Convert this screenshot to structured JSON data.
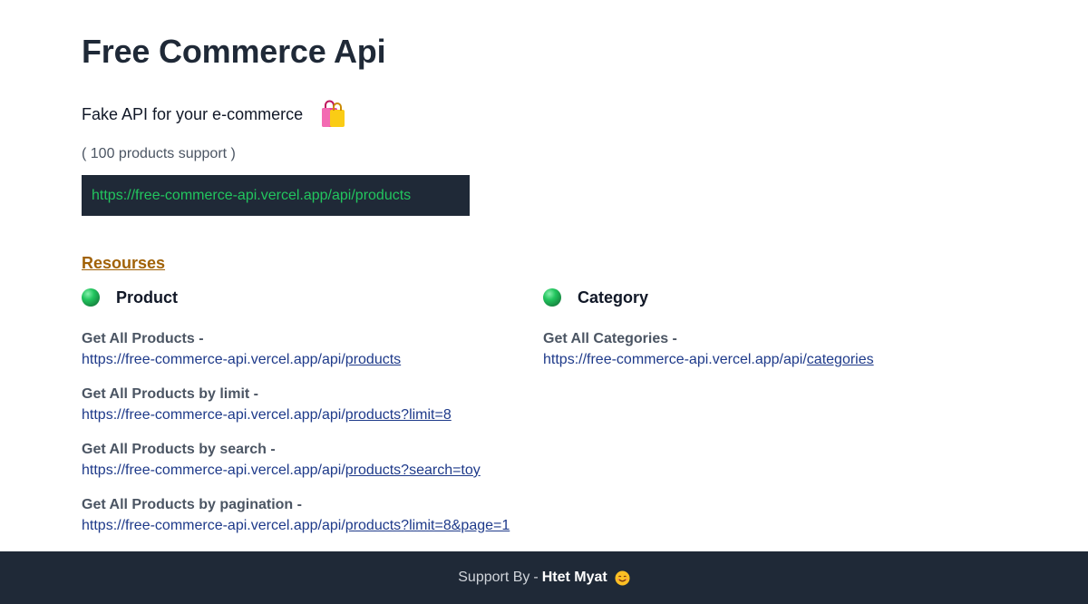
{
  "header": {
    "title": "Free Commerce Api",
    "tagline": "Fake API for your e-commerce",
    "tagline_icon": "shopping-bags-icon",
    "support_count": "( 100 products support )",
    "base_url": "https://free-commerce-api.vercel.app/api/products"
  },
  "resources": {
    "heading": "Resourses",
    "product": {
      "label": "Product",
      "icon": "green-circle-icon",
      "endpoints": [
        {
          "title": "Get All Products -",
          "base": "https://free-commerce-api.vercel.app/api/",
          "path": "products"
        },
        {
          "title": "Get All Products by limit -",
          "base": "https://free-commerce-api.vercel.app/api/",
          "path": "products?limit=8"
        },
        {
          "title": "Get All Products by search -",
          "base": "https://free-commerce-api.vercel.app/api/",
          "path": "products?search=toy"
        },
        {
          "title": "Get All Products by pagination -",
          "base": "https://free-commerce-api.vercel.app/api/",
          "path": "products?limit=8&page=1"
        }
      ]
    },
    "category": {
      "label": "Category",
      "icon": "green-circle-icon",
      "endpoints": [
        {
          "title": "Get All Categories -",
          "base": "https://free-commerce-api.vercel.app/api/",
          "path": "categories"
        }
      ]
    }
  },
  "footer": {
    "label": "Support By",
    "separator": "-",
    "author": "Htet Myat",
    "icon": "smiling-face-icon"
  },
  "colors": {
    "dark_bg": "#1f2937",
    "code_text": "#22c55e",
    "resources_heading": "#a16207",
    "link": "#1e3a8a"
  }
}
